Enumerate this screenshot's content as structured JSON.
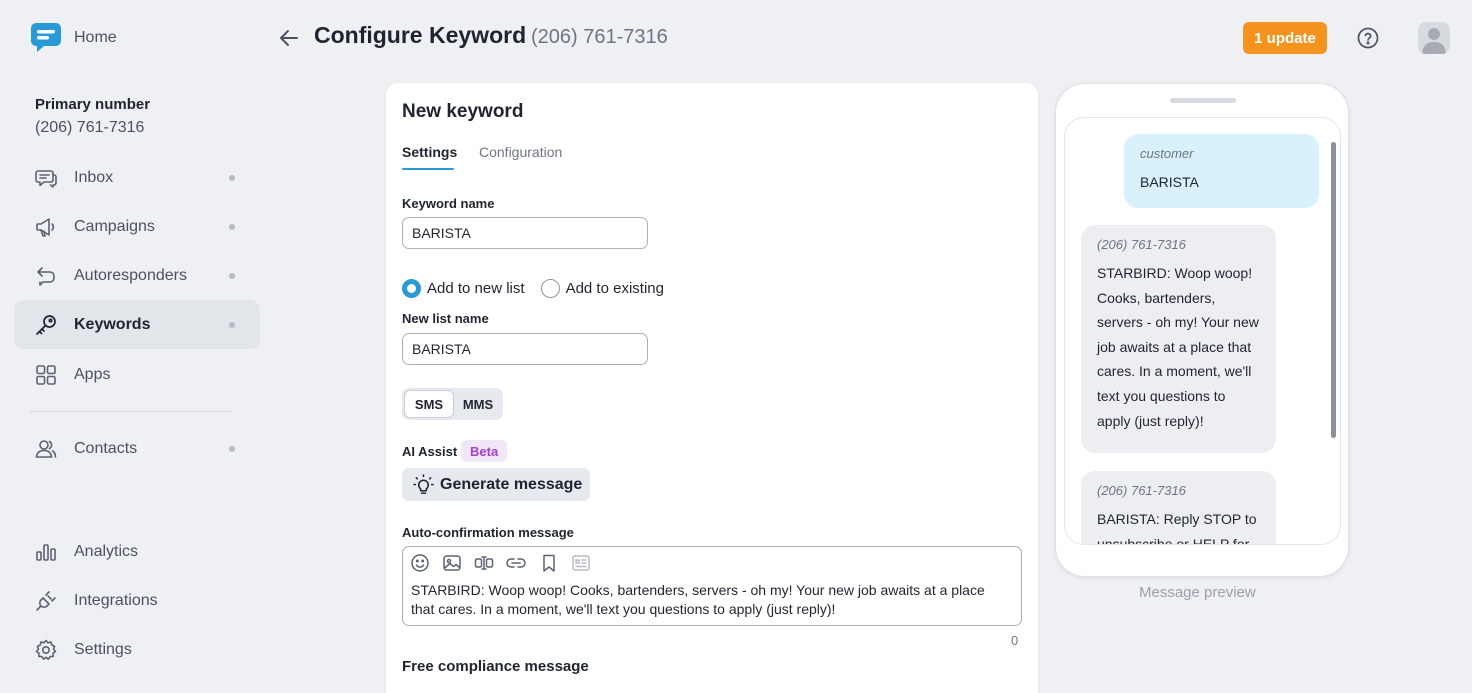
{
  "app": {
    "home_label": "Home",
    "primary_label": "Primary number",
    "primary_number": "(206) 761-7316"
  },
  "nav": {
    "inbox": "Inbox",
    "campaigns": "Campaigns",
    "autoresponders": "Autoresponders",
    "keywords": "Keywords",
    "apps": "Apps",
    "contacts": "Contacts",
    "analytics": "Analytics",
    "integrations": "Integrations",
    "settings": "Settings",
    "active": "keywords"
  },
  "header": {
    "title": "Configure Keyword",
    "subtitle": "(206) 761-7316",
    "update_label": "1 update"
  },
  "form": {
    "title": "New keyword",
    "tabs": [
      "Settings",
      "Configuration"
    ],
    "active_tab": "Settings",
    "keyword_name_label": "Keyword name",
    "keyword_name_value": "BARISTA",
    "radio_new_list": "Add to new list",
    "radio_existing": "Add to existing",
    "selected_radio": "new",
    "new_list_label": "New list name",
    "new_list_value": "BARISTA",
    "sms_label": "SMS",
    "mms_label": "MMS",
    "ai_label": "AI Assist",
    "beta_label": "Beta",
    "generate_label": "Generate message",
    "auto_conf_label": "Auto-confirmation message",
    "auto_conf_value": "STARBIRD: Woop woop! Cooks, bartenders, servers - oh my! Your new job awaits at a place that cares. In a moment, we'll text you questions to apply (just reply)!",
    "char_count": "0",
    "compliance_label": "Free compliance message"
  },
  "preview": {
    "customer_sender": "customer",
    "customer_msg": "BARISTA",
    "biz_sender": "(206) 761-7316",
    "biz_msg1": "STARBIRD: Woop woop! Cooks, bartenders, servers - oh my! Your new job awaits at a place that cares. In a moment, we'll text you questions to apply (just reply)!",
    "biz_msg2": "BARISTA: Reply STOP to unsubscribe or HELP for",
    "caption": "Message preview"
  },
  "colors": {
    "accent": "#2a9ad6",
    "update": "#f5931f",
    "beta": "#a23fc7",
    "customer_bubble": "#d9f1fb"
  }
}
